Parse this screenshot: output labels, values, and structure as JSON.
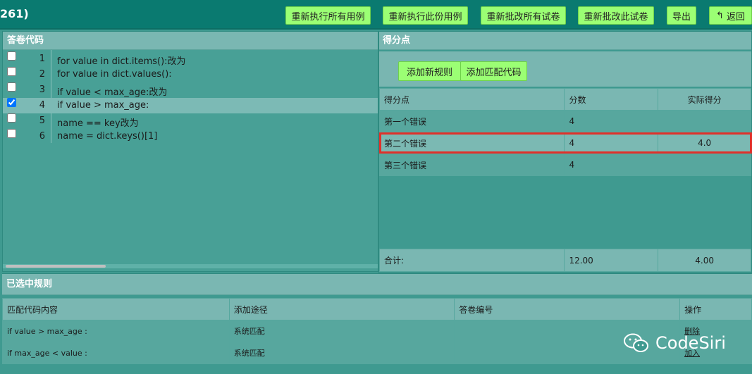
{
  "header": {
    "title": "261)",
    "buttons": {
      "rerun_all": "重新执行所有用例",
      "rerun_this": "重新执行此份用例",
      "regrade_all": "重新批改所有试卷",
      "regrade_this": "重新批改此试卷",
      "export": "导出",
      "back": "返回"
    }
  },
  "answer_code": {
    "title": "答卷代码",
    "lines": [
      {
        "num": "1",
        "code": "for value in dict.items():改为",
        "checked": false
      },
      {
        "num": "2",
        "code": "for value in dict.values():",
        "checked": false
      },
      {
        "num": "3",
        "code": "if value < max_age:改为",
        "checked": false
      },
      {
        "num": "4",
        "code": "if value > max_age:",
        "checked": true
      },
      {
        "num": "5",
        "code": "name == key改为",
        "checked": false
      },
      {
        "num": "6",
        "code": "name = dict.keys()[1]",
        "checked": false
      }
    ]
  },
  "scoring": {
    "title": "得分点",
    "add_rule": "添加新规则",
    "add_match_code": "添加匹配代码",
    "columns": [
      "得分点",
      "分数",
      "实际得分"
    ],
    "rows": [
      {
        "name": "第一个错误",
        "score": "4",
        "actual": ""
      },
      {
        "name": "第二个错误",
        "score": "4",
        "actual": "4.0"
      },
      {
        "name": "第三个错误",
        "score": "4",
        "actual": ""
      }
    ],
    "total_label": "合计:",
    "total_score": "12.00",
    "total_actual": "4.00"
  },
  "selected_rules": {
    "title": "已选中规则",
    "columns": [
      "匹配代码内容",
      "添加途径",
      "答卷编号",
      "操作"
    ],
    "rows": [
      {
        "content": "if value > max_age :",
        "source": "系统匹配",
        "paper_no": "",
        "action": "删除"
      },
      {
        "content": "if max_age < value :",
        "source": "系统匹配",
        "paper_no": "",
        "action": "加入"
      }
    ]
  },
  "watermark": {
    "text": "CodeSiri",
    "icon": "wechat-icon"
  },
  "colors": {
    "accent_button": "#9bff74",
    "header_bg": "#0a7a70",
    "highlight_border": "#e0302a"
  }
}
